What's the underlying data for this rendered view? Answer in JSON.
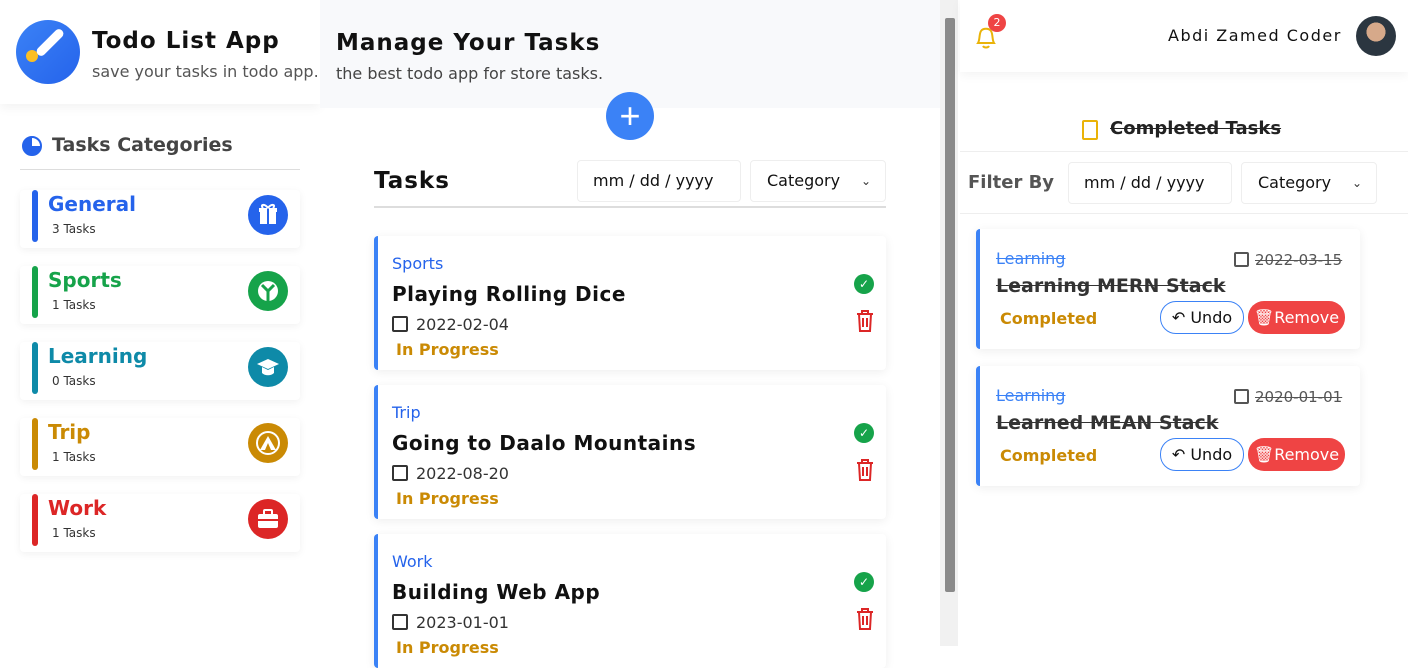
{
  "brand": {
    "title": "Todo List App",
    "subtitle": "save your tasks in todo app.",
    "logo_icon": "check-pen-icon"
  },
  "sidebar": {
    "heading": "Tasks Categories",
    "items": [
      {
        "name": "General",
        "count": "3 Tasks",
        "color": "#2563eb",
        "icon": "gift-icon"
      },
      {
        "name": "Sports",
        "count": "1 Tasks",
        "color": "#16a34a",
        "icon": "ball-icon"
      },
      {
        "name": "Learning",
        "count": "0 Tasks",
        "color": "#0e8aa8",
        "icon": "graduation-cap-icon"
      },
      {
        "name": "Trip",
        "count": "1 Tasks",
        "color": "#ca8a04",
        "icon": "mountain-icon"
      },
      {
        "name": "Work",
        "count": "1 Tasks",
        "color": "#dc2626",
        "icon": "briefcase-icon"
      }
    ]
  },
  "main": {
    "title": "Manage Your Tasks",
    "subtitle": "the best todo app for store tasks.",
    "add_label": "+",
    "tasks_heading": "Tasks",
    "date_placeholder": "mm / dd / yyyy",
    "category_select": "Category",
    "tasks": [
      {
        "category": "Sports",
        "title": "Playing Rolling Dice",
        "date": "2022-02-04",
        "status": "In Progress"
      },
      {
        "category": "Trip",
        "title": "Going to Daalo Mountains",
        "date": "2022-08-20",
        "status": "In Progress"
      },
      {
        "category": "Work",
        "title": "Building Web App",
        "date": "2023-01-01",
        "status": "In Progress"
      }
    ]
  },
  "header": {
    "notification_count": "2",
    "user_name": "Abdi Zamed Coder"
  },
  "completed": {
    "heading": "Completed Tasks",
    "filter_label": "Filter By",
    "date_placeholder": "mm / dd / yyyy",
    "category_select": "Category",
    "undo_label": "Undo",
    "remove_label": "Remove",
    "tasks": [
      {
        "category": "Learning",
        "title": "Learning MERN Stack",
        "date": "2022-03-15",
        "status": "Completed"
      },
      {
        "category": "Learning",
        "title": "Learned MEAN Stack",
        "date": "2020-01-01",
        "status": "Completed"
      }
    ]
  },
  "colors": {
    "accent": "#3b82f6",
    "progress": "#ca8a04",
    "danger": "#ef4444",
    "success": "#16a34a"
  }
}
